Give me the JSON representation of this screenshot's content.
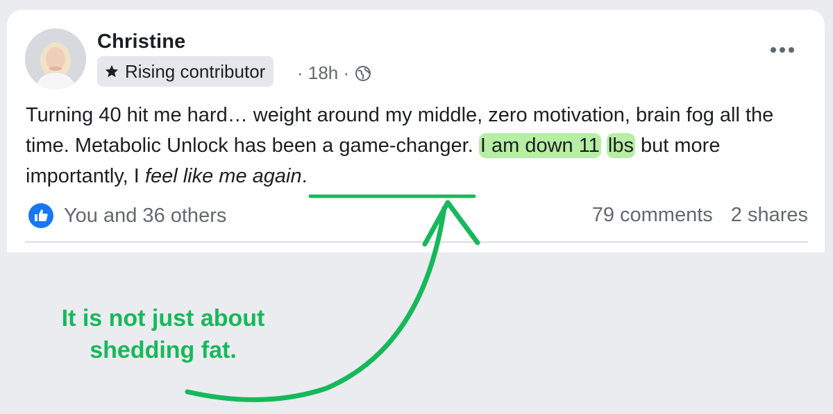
{
  "post": {
    "author": "Christine",
    "badge": "Rising contributor",
    "time": "· 18h ·",
    "body": {
      "part1": "Turning 40 hit me hard… weight around my middle, zero motivation, brain fog all the time. Metabolic Unlock has been a game-changer. ",
      "highlight1": "I am down 11",
      "space": " ",
      "highlight2": "lbs",
      "part2": " but more importantly, I ",
      "italic": "feel like me again",
      "end": "."
    },
    "reactions_text": "You and 36 others",
    "comments": "79 comments",
    "shares": "2 shares"
  },
  "icons": {
    "badge": "star-icon",
    "privacy": "globe-icon",
    "reaction": "like-icon",
    "menu": "more-options-icon"
  },
  "annotation": {
    "line1": "It is not just about",
    "line2": "shedding fat."
  },
  "colors": {
    "accent_green": "#17b85a",
    "highlight": "#b6eea4",
    "like_blue": "#1877f2"
  }
}
